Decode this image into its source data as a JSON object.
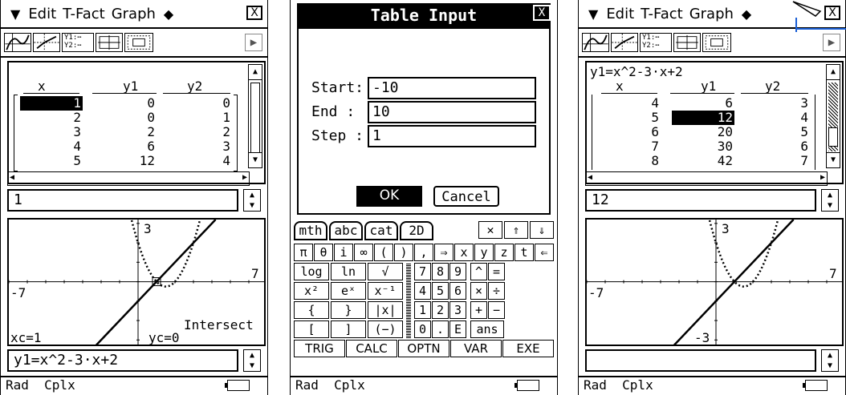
{
  "menu": {
    "items": [
      "Edit",
      "T-Fact",
      "Graph"
    ],
    "close_label": "X"
  },
  "table": {
    "headers": [
      "x",
      "y1",
      "y2"
    ],
    "screen1_rows": [
      [
        "1",
        "0",
        "0"
      ],
      [
        "2",
        "0",
        "1"
      ],
      [
        "3",
        "2",
        "2"
      ],
      [
        "4",
        "6",
        "3"
      ],
      [
        "5",
        "12",
        "4"
      ]
    ],
    "screen3_expr": "y1=x^2-3·x+2",
    "screen3_rows": [
      [
        "4",
        "6",
        "3"
      ],
      [
        "5",
        "12",
        "4"
      ],
      [
        "6",
        "20",
        "5"
      ],
      [
        "7",
        "30",
        "6"
      ],
      [
        "8",
        "42",
        "7"
      ]
    ]
  },
  "entry": {
    "screen1_value": "1",
    "screen3_value": "12"
  },
  "graph": {
    "screen1": {
      "ymax_label": "3",
      "xmax_label": "7",
      "xmin_label": "-7",
      "xc_label": "xc=1",
      "yc_label": "yc=0",
      "mode_label": "Intersect"
    },
    "screen3": {
      "ymax_label": "3",
      "xmax_label": "7",
      "xmin_label": "-7",
      "ymin_label": "-3"
    }
  },
  "expression_bar": {
    "screen1_value": "y1=x^2-3·x+2",
    "screen3_value": ""
  },
  "status": {
    "left": "Rad  Cplx"
  },
  "dialog": {
    "title": "Table Input",
    "close_label": "X",
    "fields": [
      {
        "label": "Start:",
        "value": "-10"
      },
      {
        "label": "End  :",
        "value": "10"
      },
      {
        "label": "Step :",
        "value": "1"
      }
    ],
    "ok_label": "OK",
    "cancel_label": "Cancel"
  },
  "keyboard": {
    "tabs": [
      "mth",
      "abc",
      "cat",
      "2D"
    ],
    "row1": [
      "π",
      "θ",
      "i",
      "∞",
      "(",
      ")",
      ",",
      "⇒",
      "x",
      "y",
      "z",
      "t",
      "⇐"
    ],
    "row2_left": [
      "log",
      "ln",
      "√"
    ],
    "row2_right": [
      "7",
      "8",
      "9",
      "^",
      "="
    ],
    "row3_left": [
      "x²",
      "eˣ",
      "x⁻¹"
    ],
    "row3_right": [
      "4",
      "5",
      "6",
      "×",
      "÷"
    ],
    "row4_left": [
      "{",
      "}",
      "|x|"
    ],
    "row4_right": [
      "1",
      "2",
      "3",
      "+",
      "−"
    ],
    "row5_left": [
      "[",
      "]",
      "(−)"
    ],
    "row5_right": [
      "0",
      ".",
      "E",
      "ans"
    ],
    "row6": [
      "TRIG",
      "CALC",
      "OPTN",
      "VAR",
      "EXE"
    ]
  }
}
